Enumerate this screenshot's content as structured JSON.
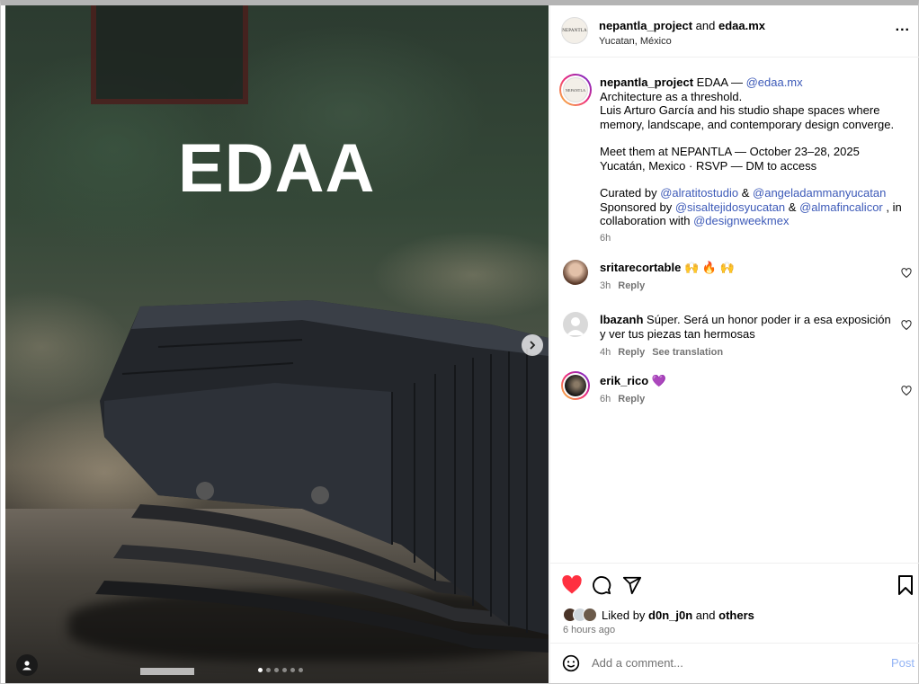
{
  "media": {
    "headline": "EDAA",
    "carousel_count": 6,
    "carousel_active_index": 0
  },
  "header": {
    "account": "nepantla_project",
    "joiner": "and",
    "collaborator": "edaa.mx",
    "location": "Yucatan, México",
    "avatar_text": "NEPANTLA",
    "more_label": "..."
  },
  "caption": {
    "avatar_text": "NEPANTLA",
    "username": "nepantla_project",
    "line1_prefix": "EDAA — ",
    "line1_mention": "@edaa.mx",
    "line2": "Architecture as a threshold.",
    "line3": "Luis Arturo García and his studio shape spaces where memory, landscape, and contemporary design converge.",
    "line4": "Meet them at NEPANTLA — October 23–28, 2025",
    "line5": "Yucatán, Mexico · RSVP — DM to access",
    "curated_prefix": "Curated by ",
    "curated_mention1": "@alratitostudio",
    "curated_and": " & ",
    "curated_mention2": "@angeladammanyucatan",
    "sponsored_prefix": "Sponsored by ",
    "sponsored_mention1": "@sisaltejidosyucatan",
    "sponsored_and": " & ",
    "sponsored_mention2": "@almafincalicor",
    "sponsored_suffix": " , in collaboration with ",
    "sponsored_mention3": "@designweekmex",
    "time": "6h"
  },
  "comments": [
    {
      "username": "sritarecortable",
      "text": "🙌 🔥 🙌",
      "time": "3h",
      "reply": "Reply",
      "translate": ""
    },
    {
      "username": "lbazanh",
      "text": "Súper. Será un honor poder ir a esa exposición y ver tus piezas tan hermosas",
      "time": "4h",
      "reply": "Reply",
      "translate": "See translation"
    },
    {
      "username": "erik_rico",
      "text": "💜",
      "time": "6h",
      "reply": "Reply",
      "translate": ""
    }
  ],
  "likes": {
    "prefix": "Liked by",
    "user": "d0n_j0n",
    "joiner": "and",
    "others": "others",
    "ago": "6 hours ago"
  },
  "composer": {
    "placeholder": "Add a comment...",
    "post_label": "Post"
  },
  "colors": {
    "like_red": "#ff3040",
    "link_blue": "#3d5ab8",
    "post_blue": "#93b4f5",
    "muted": "#737373"
  }
}
